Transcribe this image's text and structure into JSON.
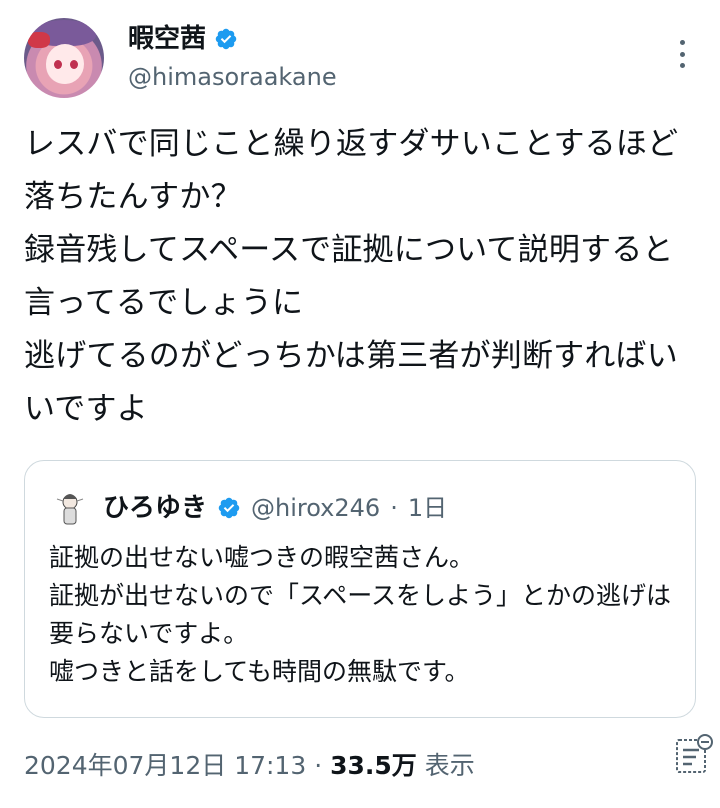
{
  "tweet": {
    "author": {
      "display_name": "暇空茜",
      "handle": "@himasoraakane"
    },
    "text": "レスバで同じこと繰り返すダサいことするほど落ちたんすか？\n録音残してスペースで証拠について説明すると言ってるでしょうに\n逃げてるのがどっちかは第三者が判断すればいいですよ",
    "quoted": {
      "author_name": "ひろゆき",
      "author_handle": "@hirox246",
      "separator": "·",
      "time": "1日",
      "text": "証拠の出せない嘘つきの暇空茜さん。\n証拠が出せないので「スペースをしよう」とかの逃げは要らないですよ。\n嘘つきと話をしても時間の無駄です。"
    },
    "footer": {
      "timestamp": "2024年07月12日 17:13",
      "dot": "·",
      "views_count": "33.5万",
      "views_label": "表示"
    }
  },
  "colors": {
    "verified_blue": "#1d9bf0",
    "text_primary": "#0f1419",
    "text_secondary": "#536471",
    "border": "#cfd9de"
  },
  "icons": [
    "verified-badge-icon",
    "more-options-icon",
    "analytics-icon"
  ]
}
